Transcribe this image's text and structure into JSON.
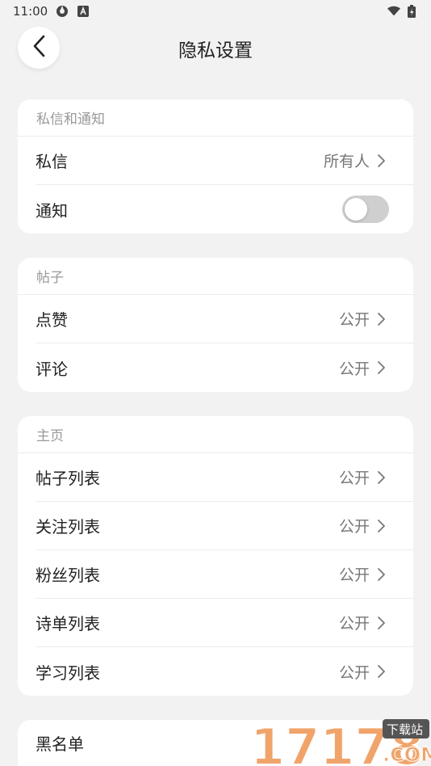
{
  "status_bar": {
    "time": "11:00"
  },
  "header": {
    "title": "隐私设置"
  },
  "sections": [
    {
      "title": "私信和通知",
      "rows": [
        {
          "label": "私信",
          "value": "所有人",
          "type": "link"
        },
        {
          "label": "通知",
          "type": "toggle",
          "on": false
        }
      ]
    },
    {
      "title": "帖子",
      "rows": [
        {
          "label": "点赞",
          "value": "公开",
          "type": "link"
        },
        {
          "label": "评论",
          "value": "公开",
          "type": "link"
        }
      ]
    },
    {
      "title": "主页",
      "rows": [
        {
          "label": "帖子列表",
          "value": "公开",
          "type": "link"
        },
        {
          "label": "关注列表",
          "value": "公开",
          "type": "link"
        },
        {
          "label": "粉丝列表",
          "value": "公开",
          "type": "link"
        },
        {
          "label": "诗单列表",
          "value": "公开",
          "type": "link"
        },
        {
          "label": "学习列表",
          "value": "公开",
          "type": "link"
        }
      ]
    }
  ],
  "blacklist": {
    "label": "黑名单"
  },
  "watermark": {
    "number": "17178",
    "badge": "下载站",
    "domain": ".COM"
  },
  "colors": {
    "background": "#f2f2f2",
    "card": "#ffffff",
    "toggle_off": "#cfcfcf",
    "watermark": "#f0a46a"
  }
}
